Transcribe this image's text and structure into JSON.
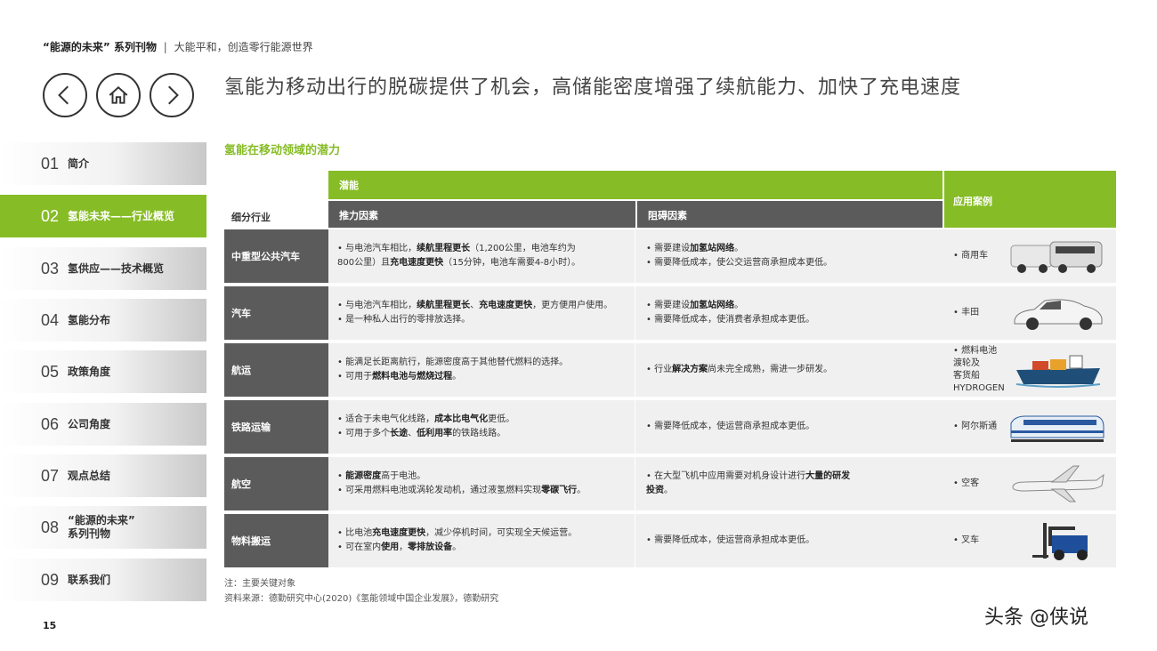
{
  "header": {
    "series_title": "“能源的未来” 系列刊物",
    "separator": "|",
    "subtitle": "大能平和，创造零行能源世界"
  },
  "nav": {
    "back_icon": "chevron-left-icon",
    "home_icon": "home-icon",
    "forward_icon": "chevron-right-icon"
  },
  "main_heading": "氢能为移动出行的脱碳提供了机会，高储能密度增强了续航能力、加快了充电速度",
  "sidebar": {
    "items": [
      {
        "num": "01",
        "label": "简介"
      },
      {
        "num": "02",
        "label": "氢能未来——行业概览"
      },
      {
        "num": "03",
        "label": "氢供应——技术概览"
      },
      {
        "num": "04",
        "label": "氢能分布"
      },
      {
        "num": "05",
        "label": "政策角度"
      },
      {
        "num": "06",
        "label": "公司角度"
      },
      {
        "num": "07",
        "label": "观点总结"
      },
      {
        "num": "08",
        "label": "“能源的未来”\n系列刊物"
      },
      {
        "num": "09",
        "label": "联系我们"
      }
    ],
    "active_index": 1
  },
  "subhead": "氢能在移动领域的潜力",
  "table": {
    "segment_header": "细分行业",
    "group_header": "潜能",
    "driver_header": "推力因素",
    "barrier_header": "阻碍因素",
    "example_header": "应用案例",
    "rows": [
      {
        "segment": "中重型公共汽车",
        "driver": [
          {
            "pre": "• 与电池汽车相比，",
            "bold": "续航里程更长",
            "post": "（1,200公里，电池车约为"
          },
          {
            "pre": "800公里）且",
            "bold": "充电速度更快",
            "post": "（15分钟，电池车需要4-8小时）。"
          }
        ],
        "barrier": [
          {
            "pre": "• 需要建设",
            "bold": "加氢站网络",
            "post": "。"
          },
          {
            "pre": "• 需要降低成本，使公交运营商承担成本更低。",
            "bold": "",
            "post": ""
          }
        ],
        "example": "• 商用车",
        "image": "bus-truck-icon"
      },
      {
        "segment": "汽车",
        "driver": [
          {
            "pre": "• 与电池汽车相比，",
            "bold": "续航里程更长",
            "post": "、"
          },
          {
            "pre": "",
            "bold": "充电速度更快",
            "post": "，更方便用户使用。"
          },
          {
            "pre": "• 是一种私人出行的零排放选择。",
            "bold": "",
            "post": ""
          }
        ],
        "barrier": [
          {
            "pre": "• 需要建设",
            "bold": "加氢站网络",
            "post": "。"
          },
          {
            "pre": "• 需要降低成本，使消费者承担成本更低。",
            "bold": "",
            "post": ""
          }
        ],
        "example": "• 丰田",
        "image": "car-icon"
      },
      {
        "segment": "航运",
        "driver": [
          {
            "pre": "• 能满足长距离航行，能源密度高于其他替代燃料的选择。",
            "bold": "",
            "post": ""
          },
          {
            "pre": "• 可用于",
            "bold": "燃料电池与燃烧过程",
            "post": "。"
          }
        ],
        "barrier": [
          {
            "pre": "• 行业",
            "bold": "解决方案",
            "post": "尚未完全成熟，需进一步研发。"
          }
        ],
        "example": "• 燃料电池\n  渡轮及\n  客货船  HYDROGEN",
        "image": "ship-icon"
      },
      {
        "segment": "铁路运输",
        "driver": [
          {
            "pre": "• 适合于未电气化线路，",
            "bold": "成本比电气化",
            "post": "更低。"
          },
          {
            "pre": "• 可用于多个",
            "bold": "长途",
            "post": "、"
          },
          {
            "pre": "",
            "bold": "低利用率",
            "post": "的铁路线路。"
          }
        ],
        "barrier": [
          {
            "pre": "• 需要降低成本，使运营商承担成本更低。",
            "bold": "",
            "post": ""
          }
        ],
        "example": "• 阿尔斯通",
        "image": "train-icon"
      },
      {
        "segment": "航空",
        "driver": [
          {
            "pre": "• ",
            "bold": "能源密度",
            "post": "高于电池。"
          },
          {
            "pre": "• 可采用燃料电池或涡轮发动机，通过液氢燃料实现",
            "bold": "零碳飞行",
            "post": "。"
          }
        ],
        "barrier": [
          {
            "pre": "• 在大型飞机中应用需要对机身设计进行",
            "bold": "大量的研发",
            "post": ""
          },
          {
            "pre": "",
            "bold": "投资",
            "post": "。"
          }
        ],
        "example": "• 空客",
        "image": "airplane-icon"
      },
      {
        "segment": "物料搬运",
        "driver": [
          {
            "pre": "• 比电池",
            "bold": "充电速度更快",
            "post": "，减少停机时间，可实现全天候运营。"
          },
          {
            "pre": "• 可在室内",
            "bold": "使用",
            "post": "，"
          },
          {
            "pre": "",
            "bold": "零排放设备",
            "post": "。"
          }
        ],
        "barrier": [
          {
            "pre": "• 需要降低成本，使运营商承担成本更低。",
            "bold": "",
            "post": ""
          }
        ],
        "example": "• 叉车",
        "image": "forklift-icon"
      }
    ]
  },
  "notes": {
    "line1": "注：主要关键对象",
    "line2": "资料来源：德勤研究中心(2020)《氢能领域中国企业发展》，德勤研究"
  },
  "page_number": "15",
  "watermark": "头条 @侠说",
  "colors": {
    "accent": "#86bc25",
    "dark_gray": "#5b5b5b",
    "row_bg": "#f0f0f0"
  }
}
